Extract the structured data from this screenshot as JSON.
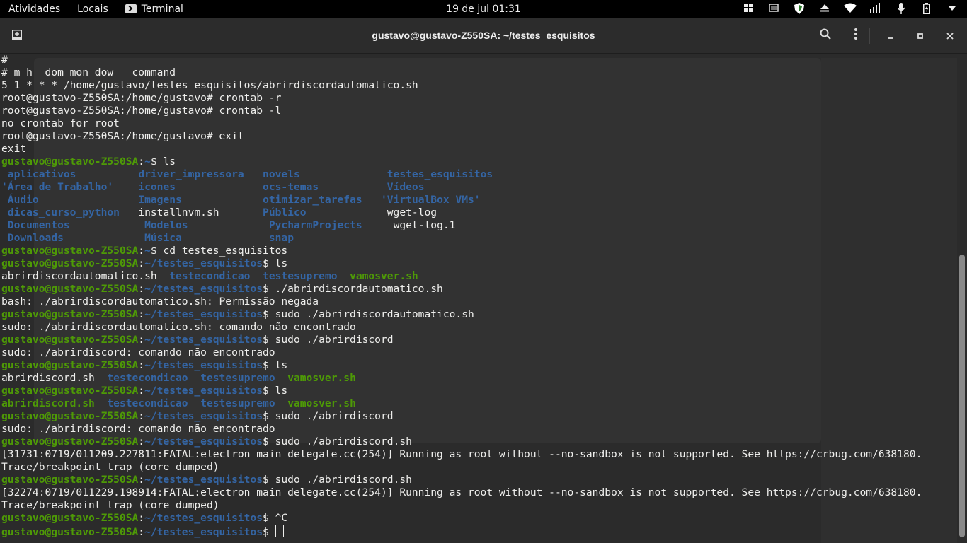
{
  "topbar": {
    "activities": "Atividades",
    "places": "Locais",
    "app": "Terminal",
    "clock": "19 de jul  01:31"
  },
  "window": {
    "title": "gustavo@gustavo-Z550SA: ~/testes_esquisitos"
  },
  "terminal": {
    "user_host": "gustavo@gustavo-Z550SA",
    "home": "~",
    "cwd": "~/testes_esquisitos",
    "lines": [
      {
        "seg": [
          {
            "t": "#"
          }
        ]
      },
      {
        "seg": [
          {
            "t": "# m h  dom mon dow   command"
          }
        ]
      },
      {
        "seg": [
          {
            "t": "5 1 * * * /home/gustavo/testes_esquisitos/abrirdiscordautomatico.sh"
          }
        ]
      },
      {
        "seg": [
          {
            "t": "root@gustavo-Z550SA:/home/gustavo# crontab -r"
          }
        ]
      },
      {
        "seg": [
          {
            "t": "root@gustavo-Z550SA:/home/gustavo# crontab -l"
          }
        ]
      },
      {
        "seg": [
          {
            "t": "no crontab for root"
          }
        ]
      },
      {
        "seg": [
          {
            "t": "root@gustavo-Z550SA:/home/gustavo# exit"
          }
        ]
      },
      {
        "seg": [
          {
            "t": "exit"
          }
        ]
      },
      {
        "seg": [
          {
            "t": "gustavo@gustavo-Z550SA",
            "c": "u"
          },
          {
            "t": ":"
          },
          {
            "t": "~",
            "c": "p"
          },
          {
            "t": "$ ls"
          }
        ]
      },
      {
        "seg": [
          {
            "t": " aplicativos ",
            "c": "dir"
          },
          {
            "t": "         "
          },
          {
            "t": "driver_impressora",
            "c": "dir"
          },
          {
            "t": "   "
          },
          {
            "t": "novels",
            "c": "dir"
          },
          {
            "t": "              "
          },
          {
            "t": "testes_esquisitos",
            "c": "dir"
          }
        ]
      },
      {
        "seg": [
          {
            "t": "'Área de Trabalho'",
            "c": "dir"
          },
          {
            "t": "    "
          },
          {
            "t": "icones",
            "c": "dir"
          },
          {
            "t": "              "
          },
          {
            "t": "ocs-temas",
            "c": "dir"
          },
          {
            "t": "           "
          },
          {
            "t": "Vídeos",
            "c": "dir"
          }
        ]
      },
      {
        "seg": [
          {
            "t": " Áudio",
            "c": "dir"
          },
          {
            "t": "                "
          },
          {
            "t": "Imagens",
            "c": "dir"
          },
          {
            "t": "             "
          },
          {
            "t": "otimizar_tarefas",
            "c": "dir"
          },
          {
            "t": "   "
          },
          {
            "t": "'VirtualBox VMs'",
            "c": "dir"
          }
        ]
      },
      {
        "seg": [
          {
            "t": " dicas_curso_python",
            "c": "dir"
          },
          {
            "t": "   installnvm.sh       "
          },
          {
            "t": "Público",
            "c": "dir"
          },
          {
            "t": "             wget-log"
          }
        ]
      },
      {
        "seg": [
          {
            "t": " Documentos",
            "c": "dir"
          },
          {
            "t": "            "
          },
          {
            "t": "Modelos",
            "c": "dir"
          },
          {
            "t": "             "
          },
          {
            "t": "PycharmProjects",
            "c": "dir"
          },
          {
            "t": "     wget-log.1"
          }
        ]
      },
      {
        "seg": [
          {
            "t": " Downloads",
            "c": "dir"
          },
          {
            "t": "             "
          },
          {
            "t": "Música",
            "c": "dir"
          },
          {
            "t": "              "
          },
          {
            "t": "snap",
            "c": "dir"
          }
        ]
      },
      {
        "seg": [
          {
            "t": "gustavo@gustavo-Z550SA",
            "c": "u"
          },
          {
            "t": ":"
          },
          {
            "t": "~",
            "c": "p"
          },
          {
            "t": "$ cd testes_esquisitos"
          }
        ]
      },
      {
        "seg": [
          {
            "t": "gustavo@gustavo-Z550SA",
            "c": "u"
          },
          {
            "t": ":"
          },
          {
            "t": "~/testes_esquisitos",
            "c": "p"
          },
          {
            "t": "$ ls"
          }
        ]
      },
      {
        "seg": [
          {
            "t": "abrirdiscordautomatico.sh  "
          },
          {
            "t": "testecondicao",
            "c": "dir"
          },
          {
            "t": "  "
          },
          {
            "t": "testesupremo",
            "c": "dir"
          },
          {
            "t": "  "
          },
          {
            "t": "vamosver.sh",
            "c": "exe"
          }
        ]
      },
      {
        "seg": [
          {
            "t": "gustavo@gustavo-Z550SA",
            "c": "u"
          },
          {
            "t": ":"
          },
          {
            "t": "~/testes_esquisitos",
            "c": "p"
          },
          {
            "t": "$ ./abrirdiscordautomatico.sh"
          }
        ]
      },
      {
        "seg": [
          {
            "t": "bash: ./abrirdiscordautomatico.sh: Permissão negada"
          }
        ]
      },
      {
        "seg": [
          {
            "t": "gustavo@gustavo-Z550SA",
            "c": "u"
          },
          {
            "t": ":"
          },
          {
            "t": "~/testes_esquisitos",
            "c": "p"
          },
          {
            "t": "$ sudo ./abrirdiscordautomatico.sh"
          }
        ]
      },
      {
        "seg": [
          {
            "t": "sudo: ./abrirdiscordautomatico.sh: comando não encontrado"
          }
        ]
      },
      {
        "seg": [
          {
            "t": "gustavo@gustavo-Z550SA",
            "c": "u"
          },
          {
            "t": ":"
          },
          {
            "t": "~/testes_esquisitos",
            "c": "p"
          },
          {
            "t": "$ sudo ./abrirdiscord"
          }
        ]
      },
      {
        "seg": [
          {
            "t": "sudo: ./abrirdiscord: comando não encontrado"
          }
        ]
      },
      {
        "seg": [
          {
            "t": "gustavo@gustavo-Z550SA",
            "c": "u"
          },
          {
            "t": ":"
          },
          {
            "t": "~/testes_esquisitos",
            "c": "p"
          },
          {
            "t": "$ ls"
          }
        ]
      },
      {
        "seg": [
          {
            "t": "abrirdiscord.sh  "
          },
          {
            "t": "testecondicao",
            "c": "dir"
          },
          {
            "t": "  "
          },
          {
            "t": "testesupremo",
            "c": "dir"
          },
          {
            "t": "  "
          },
          {
            "t": "vamosver.sh",
            "c": "exe"
          }
        ]
      },
      {
        "seg": [
          {
            "t": "gustavo@gustavo-Z550SA",
            "c": "u"
          },
          {
            "t": ":"
          },
          {
            "t": "~/testes_esquisitos",
            "c": "p"
          },
          {
            "t": "$ ls"
          }
        ]
      },
      {
        "seg": [
          {
            "t": "abrirdiscord.sh",
            "c": "exe"
          },
          {
            "t": "  "
          },
          {
            "t": "testecondicao",
            "c": "dir"
          },
          {
            "t": "  "
          },
          {
            "t": "testesupremo",
            "c": "dir"
          },
          {
            "t": "  "
          },
          {
            "t": "vamosver.sh",
            "c": "exe"
          }
        ]
      },
      {
        "seg": [
          {
            "t": "gustavo@gustavo-Z550SA",
            "c": "u"
          },
          {
            "t": ":"
          },
          {
            "t": "~/testes_esquisitos",
            "c": "p"
          },
          {
            "t": "$ sudo ./abrirdiscord"
          }
        ]
      },
      {
        "seg": [
          {
            "t": "sudo: ./abrirdiscord: comando não encontrado"
          }
        ]
      },
      {
        "seg": [
          {
            "t": "gustavo@gustavo-Z550SA",
            "c": "u"
          },
          {
            "t": ":"
          },
          {
            "t": "~/testes_esquisitos",
            "c": "p"
          },
          {
            "t": "$ sudo ./abrirdiscord.sh"
          }
        ]
      },
      {
        "seg": [
          {
            "t": "[31731:0719/011209.227811:FATAL:electron_main_delegate.cc(254)] Running as root without --no-sandbox is not supported. See https://crbug.com/638180."
          }
        ]
      },
      {
        "seg": [
          {
            "t": "Trace/breakpoint trap (core dumped)"
          }
        ]
      },
      {
        "seg": [
          {
            "t": "gustavo@gustavo-Z550SA",
            "c": "u"
          },
          {
            "t": ":"
          },
          {
            "t": "~/testes_esquisitos",
            "c": "p"
          },
          {
            "t": "$ sudo ./abrirdiscord.sh"
          }
        ]
      },
      {
        "seg": [
          {
            "t": "[32274:0719/011229.198914:FATAL:electron_main_delegate.cc(254)] Running as root without --no-sandbox is not supported. See https://crbug.com/638180."
          }
        ]
      },
      {
        "seg": [
          {
            "t": "Trace/breakpoint trap (core dumped)"
          }
        ]
      },
      {
        "seg": [
          {
            "t": "gustavo@gustavo-Z550SA",
            "c": "u"
          },
          {
            "t": ":"
          },
          {
            "t": "~/testes_esquisitos",
            "c": "p"
          },
          {
            "t": "$ ^C"
          }
        ]
      },
      {
        "seg": [
          {
            "t": "gustavo@gustavo-Z550SA",
            "c": "u"
          },
          {
            "t": ":"
          },
          {
            "t": "~/testes_esquisitos",
            "c": "p"
          },
          {
            "t": "$ "
          }
        ],
        "cursor": true
      }
    ]
  },
  "icons": {
    "new_tab": "new-tab-icon",
    "search": "search-icon",
    "menu": "hamburger-menu-icon",
    "minimize": "minimize-icon",
    "maximize": "maximize-icon",
    "close": "close-icon"
  }
}
